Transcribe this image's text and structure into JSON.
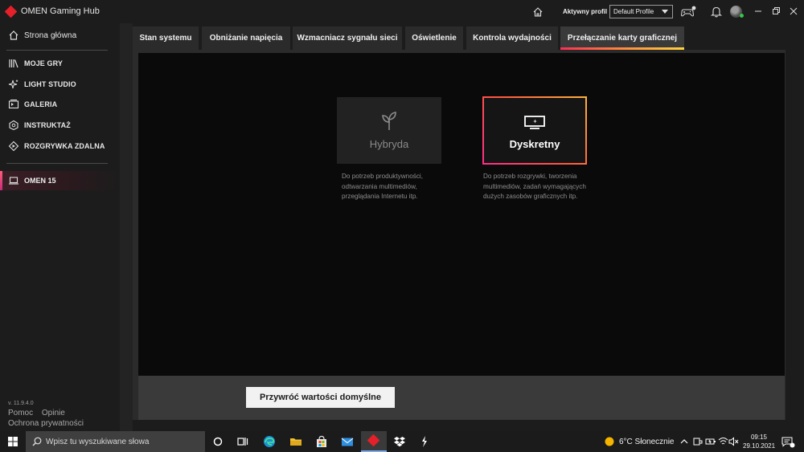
{
  "app": {
    "title": "OMEN Gaming Hub",
    "active_profile_label": "Aktywny profil",
    "profile_value": "Default Profile"
  },
  "sidebar": {
    "items": [
      {
        "label": "Strona główna",
        "icon": "home-icon"
      },
      {
        "label": "MOJE GRY",
        "icon": "library-icon"
      },
      {
        "label": "LIGHT STUDIO",
        "icon": "sparkle-icon"
      },
      {
        "label": "GALERIA",
        "icon": "gallery-icon"
      },
      {
        "label": "INSTRUKTAŻ",
        "icon": "badge-icon"
      },
      {
        "label": "ROZGRYWKA ZDALNA",
        "icon": "remote-play-icon"
      }
    ],
    "device": {
      "label": "OMEN 15",
      "icon": "laptop-icon"
    },
    "version": "v. 11.9.4.0",
    "help_link": "Pomoc",
    "feedback_link": "Opinie",
    "privacy_link": "Ochrona prywatności"
  },
  "tabs": [
    {
      "label": "Stan systemu"
    },
    {
      "label": "Obniżanie napięcia"
    },
    {
      "label": "Wzmacniacz sygnału sieci"
    },
    {
      "label": "Oświetlenie"
    },
    {
      "label": "Kontrola wydajności"
    },
    {
      "label": "Przełączanie karty graficznej",
      "active": true
    }
  ],
  "modes": {
    "hybrid": {
      "label": "Hybryda",
      "description": "Do potrzeb produktywności, odtwarzania multimediów, przeglądania Internetu itp."
    },
    "discrete": {
      "label": "Dyskretny",
      "description": "Do potrzeb rozgrywki, tworzenia multimediów, zadań wymagających dużych zasobów graficznych itp.",
      "selected": true
    }
  },
  "reset_button": "Przywróć wartości domyślne",
  "taskbar": {
    "search_placeholder": "Wpisz tu wyszukiwane słowa",
    "weather": "6°C  Słonecznie",
    "time": "09:15",
    "date": "29.10.2021"
  },
  "colors": {
    "accent_red": "#e4202a",
    "accent_gradient_start": "#ff2d55",
    "accent_gradient_end": "#ffd23d"
  }
}
